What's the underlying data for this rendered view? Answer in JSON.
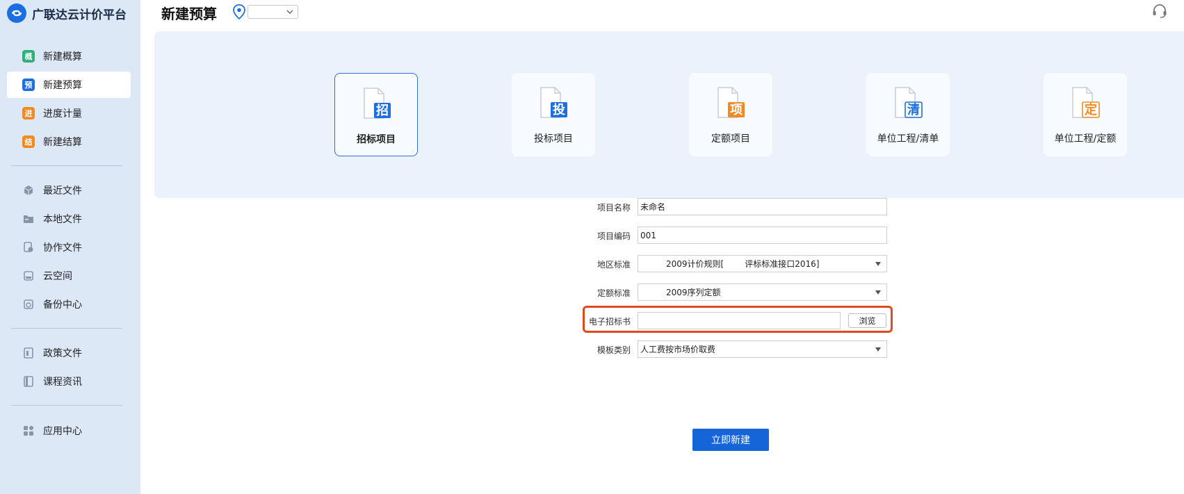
{
  "app": {
    "title": "广联达云计价平台"
  },
  "sidebar": {
    "groups": [
      [
        {
          "label": "新建概算",
          "badge": "概",
          "color": "#2fae7a"
        },
        {
          "label": "新建预算",
          "badge": "预",
          "color": "#1e6fdc",
          "active": true
        },
        {
          "label": "进度计量",
          "badge": "进",
          "color": "#f08a24"
        },
        {
          "label": "新建结算",
          "badge": "结",
          "color": "#f08a24"
        }
      ],
      [
        {
          "label": "最近文件",
          "icon": "cube-icon"
        },
        {
          "label": "本地文件",
          "icon": "folder-icon"
        },
        {
          "label": "协作文件",
          "icon": "collab-file-icon"
        },
        {
          "label": "云空间",
          "icon": "cloud-drive-icon"
        },
        {
          "label": "备份中心",
          "icon": "backup-icon"
        }
      ],
      [
        {
          "label": "政策文件",
          "icon": "policy-doc-icon"
        },
        {
          "label": "课程资讯",
          "icon": "book-icon"
        }
      ],
      [
        {
          "label": "应用中心",
          "icon": "apps-grid-icon"
        }
      ]
    ]
  },
  "header": {
    "title": "新建预算",
    "location_value": ""
  },
  "templates": [
    {
      "label": "招标项目",
      "glyph": "招",
      "color": "#1e6fdc",
      "selected": true
    },
    {
      "label": "投标项目",
      "glyph": "投",
      "color": "#1e6fdc"
    },
    {
      "label": "定额项目",
      "glyph": "项",
      "color": "#f08a24"
    },
    {
      "label": "单位工程/清单",
      "glyph": "清",
      "color": "#1e6fdc"
    },
    {
      "label": "单位工程/定额",
      "glyph": "定",
      "color": "#f08a24"
    }
  ],
  "form": {
    "project_name": {
      "label": "项目名称",
      "value": "未命名"
    },
    "project_code": {
      "label": "项目编码",
      "value": "001"
    },
    "region_standard": {
      "label": "地区标准",
      "value_a": "2009计价规则[",
      "value_b": "评标标准接口2016]"
    },
    "quota_standard": {
      "label": "定额标准",
      "value": "2009序列定额"
    },
    "e_tender": {
      "label": "电子招标书",
      "value": "",
      "browse_label": "浏览"
    },
    "template_type": {
      "label": "模板类别",
      "value": "人工费按市场价取费"
    },
    "create_label": "立即新建"
  },
  "colors": {
    "accent": "#1565d8",
    "highlight": "#e04a1f",
    "sidebar_bg": "#dde8f7",
    "panel_bg": "#ebf2fc"
  }
}
